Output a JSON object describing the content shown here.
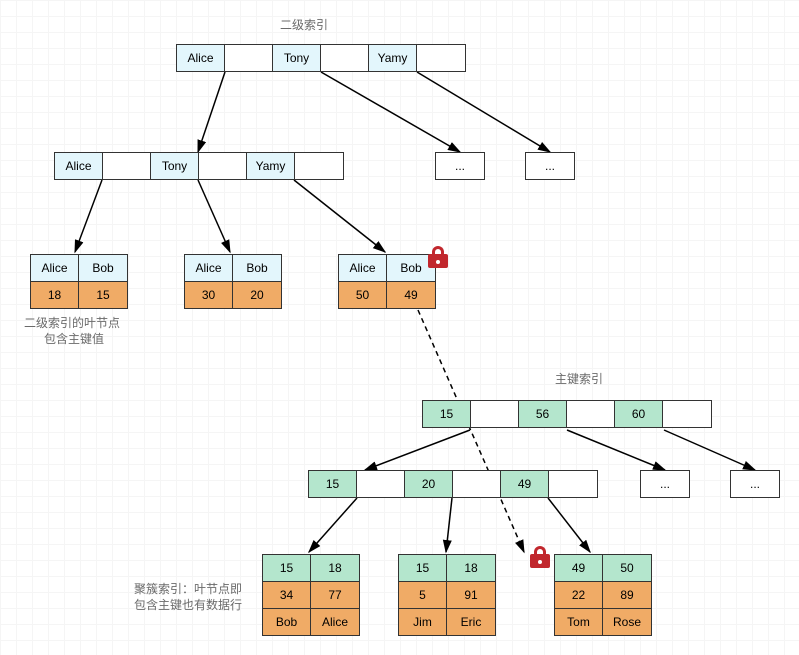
{
  "titles": {
    "secondary": "二级索引",
    "primary": "主键索引"
  },
  "captions": {
    "secondary_leaf_l1": "二级索引的叶节点",
    "secondary_leaf_l2": "包含主键值",
    "clustered_l1": "聚簇索引：叶节点即",
    "clustered_l2": "包含主键也有数据行"
  },
  "secondary": {
    "root": [
      "Alice",
      "Tony",
      "Yamy"
    ],
    "internal": [
      "Alice",
      "Tony",
      "Yamy"
    ],
    "placeholder": "...",
    "leaves": [
      {
        "names": [
          "Alice",
          "Bob"
        ],
        "pk": [
          "18",
          "15"
        ]
      },
      {
        "names": [
          "Alice",
          "Bob"
        ],
        "pk": [
          "30",
          "20"
        ]
      },
      {
        "names": [
          "Alice",
          "Bob"
        ],
        "pk": [
          "50",
          "49"
        ]
      }
    ]
  },
  "primary": {
    "root": [
      "15",
      "56",
      "60"
    ],
    "internal": [
      "15",
      "20",
      "49"
    ],
    "placeholder": "...",
    "leaves": [
      {
        "pk": [
          "15",
          "18"
        ],
        "attr": [
          "34",
          "77"
        ],
        "name": [
          "Bob",
          "Alice"
        ]
      },
      {
        "pk": [
          "15",
          "18"
        ],
        "attr": [
          "5",
          "91"
        ],
        "name": [
          "Jim",
          "Eric"
        ]
      },
      {
        "pk": [
          "49",
          "50"
        ],
        "attr": [
          "22",
          "89"
        ],
        "name": [
          "Tom",
          "Rose"
        ]
      }
    ]
  },
  "chart_data": {
    "type": "tree",
    "description": "B+Tree secondary index and clustered primary index showing row lookup via back-reference",
    "secondary_index": {
      "root_keys": [
        "Alice",
        "Tony",
        "Yamy"
      ],
      "leaf_entries": [
        {
          "key": "Alice",
          "pk": 18
        },
        {
          "key": "Bob",
          "pk": 15
        },
        {
          "key": "Alice",
          "pk": 30
        },
        {
          "key": "Bob",
          "pk": 20
        },
        {
          "key": "Alice",
          "pk": 50
        },
        {
          "key": "Bob",
          "pk": 49
        }
      ],
      "locked_leaf_block": 2
    },
    "primary_index": {
      "root_keys": [
        15,
        56,
        60
      ],
      "internal_keys": [
        15,
        20,
        49
      ],
      "leaf_rows": [
        {
          "pk": 15,
          "col": 34,
          "name": "Bob"
        },
        {
          "pk": 18,
          "col": 77,
          "name": "Alice"
        },
        {
          "pk": 15,
          "col": 5,
          "name": "Jim"
        },
        {
          "pk": 18,
          "col": 91,
          "name": "Eric"
        },
        {
          "pk": 49,
          "col": 22,
          "name": "Tom"
        },
        {
          "pk": 50,
          "col": 89,
          "name": "Rose"
        }
      ],
      "locked_leaf_block": 2
    },
    "lookup_path": {
      "from_secondary_pk": 49,
      "to_primary_pk": 49
    }
  }
}
